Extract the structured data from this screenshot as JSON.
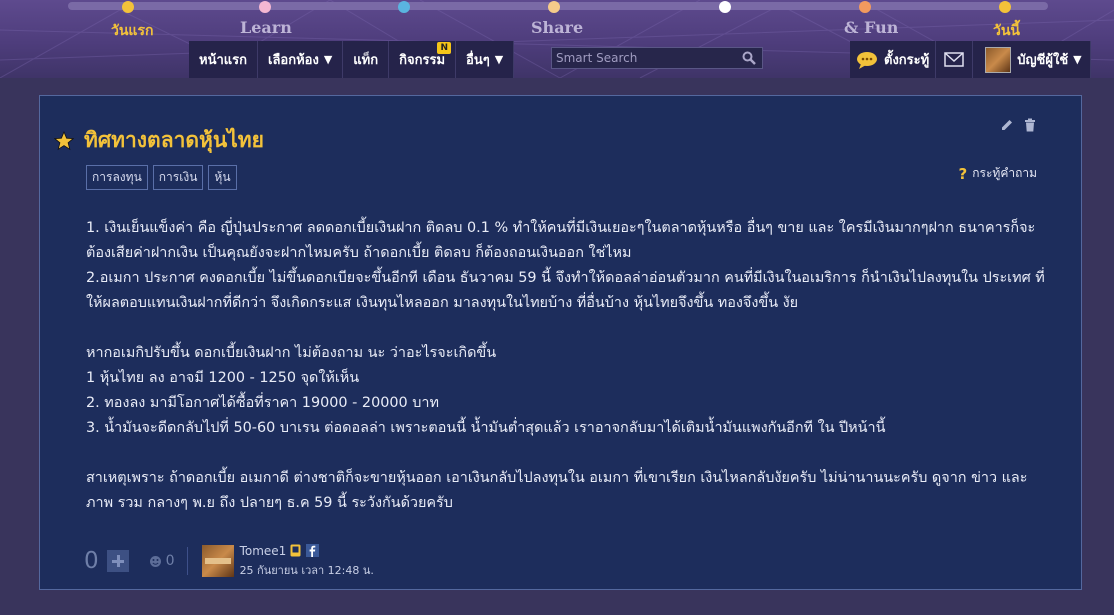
{
  "timeline": {
    "labels": [
      "วันแรก",
      "Learn",
      "Share",
      "& Fun",
      "วันนี้"
    ]
  },
  "nav": {
    "items": [
      {
        "label": "หน้าแรก",
        "has_arrow": false
      },
      {
        "label": "เลือกห้อง",
        "has_arrow": true
      },
      {
        "label": "แท็ก",
        "has_arrow": false
      },
      {
        "label": "กิจกรรม",
        "has_arrow": false,
        "badge": "N"
      },
      {
        "label": "อื่นๆ",
        "has_arrow": true
      }
    ],
    "arrow": "▼",
    "search_placeholder": "Smart Search",
    "create_topic": "ตั้งกระทู้",
    "account": "บัญชีผู้ใช้",
    "account_arrow": "▼"
  },
  "topic": {
    "title": "ทิศทางตลาดหุ้นไทย",
    "tags": [
      "การลงทุน",
      "การเงิน",
      "หุ้น"
    ],
    "type_icon": "?",
    "type_label": "กระทู้คำถาม",
    "paragraphs": [
      "1. เงินเย็นแข็งค่า คือ ญี่ปุ่นประกาศ ลดดอกเบี้ยเงินฝาก ติดลบ 0.1 % ทำให้คนที่มีเงินเยอะๆในตลาดหุ้นหรือ อื่นๆ ขาย และ ใครมีเงินมากๆฝาก ธนาคารก็จะต้องเสียค่าฝากเงิน เป็นคุณยังจะฝากไหมครับ ถ้าดอกเบี้ย ติดลบ ก็ต้องถอนเงินออก ใช่ไหม",
      "2.อเมกา ประกาศ คงดอกเบี้ย ไม่ขึ้นดอกเบียจะขึ้นอีกที เดือน ธันวาคม 59 นี้ จึงทำให้ดอลล่าอ่อนตัวมาก คนที่มีเงินในอเมริการ ก็นำเงินไปลงทุนใน ประเทศ ที่ให้ผลตอบแทนเงินฝากที่ดีกว่า จึงเกิดกระแส เงินทุนไหลออก มาลงทุนในไทยบ้าง ที่อื่นบ้าง หุ้นไทยจึงขึ้น  ทองจึงขึ้น งัย",
      "",
      "หากอเมกิปรับขึ้น ดอกเบี้ยเงินฝาก ไม่ต้องถาม นะ ว่าอะไรจะเกิดขึ้น",
      "1 หุ้นไทย ลง อาจมี 1200 - 1250 จุดให้เห็น",
      "2. ทองลง มามีโอกาศได้ซื้อที่ราคา 19000 - 20000 บาท",
      "3. น้ำมันจะดีดกลับไปที่ 50-60 บาเรน ต่อดอลล่า เพราะตอนนี้ น้ำมันต่ำสุดแล้ว เราอาจกลับมาได้เติมน้ำมันแพงกันอีกที ใน ปีหน้านี้",
      "",
      "สาเหตุเพราะ ถ้าดอกเบี้ย อเมกาดี ต่างชาติก็จะขายหุ้นออก เอาเงินกลับไปลงทุนใน อเมกา ที่เขาเรียก เงินไหลกลับงัยครับ  ไม่น่านานนะครับ ดูจาก ข่าว และภาพ รวม กลางๆ พ.ย ถึง ปลายๆ ธ.ค 59 นี้ ระวังกันด้วยครับ"
    ],
    "vote_count": "0",
    "emotion_count": "0",
    "author": "Tomee1",
    "post_time": "25 กันยายน เวลา 12:48 น."
  },
  "colors": {
    "gold": "#f3c23a",
    "card_bg": "#1d2d5c",
    "page_bg": "#39345c"
  }
}
